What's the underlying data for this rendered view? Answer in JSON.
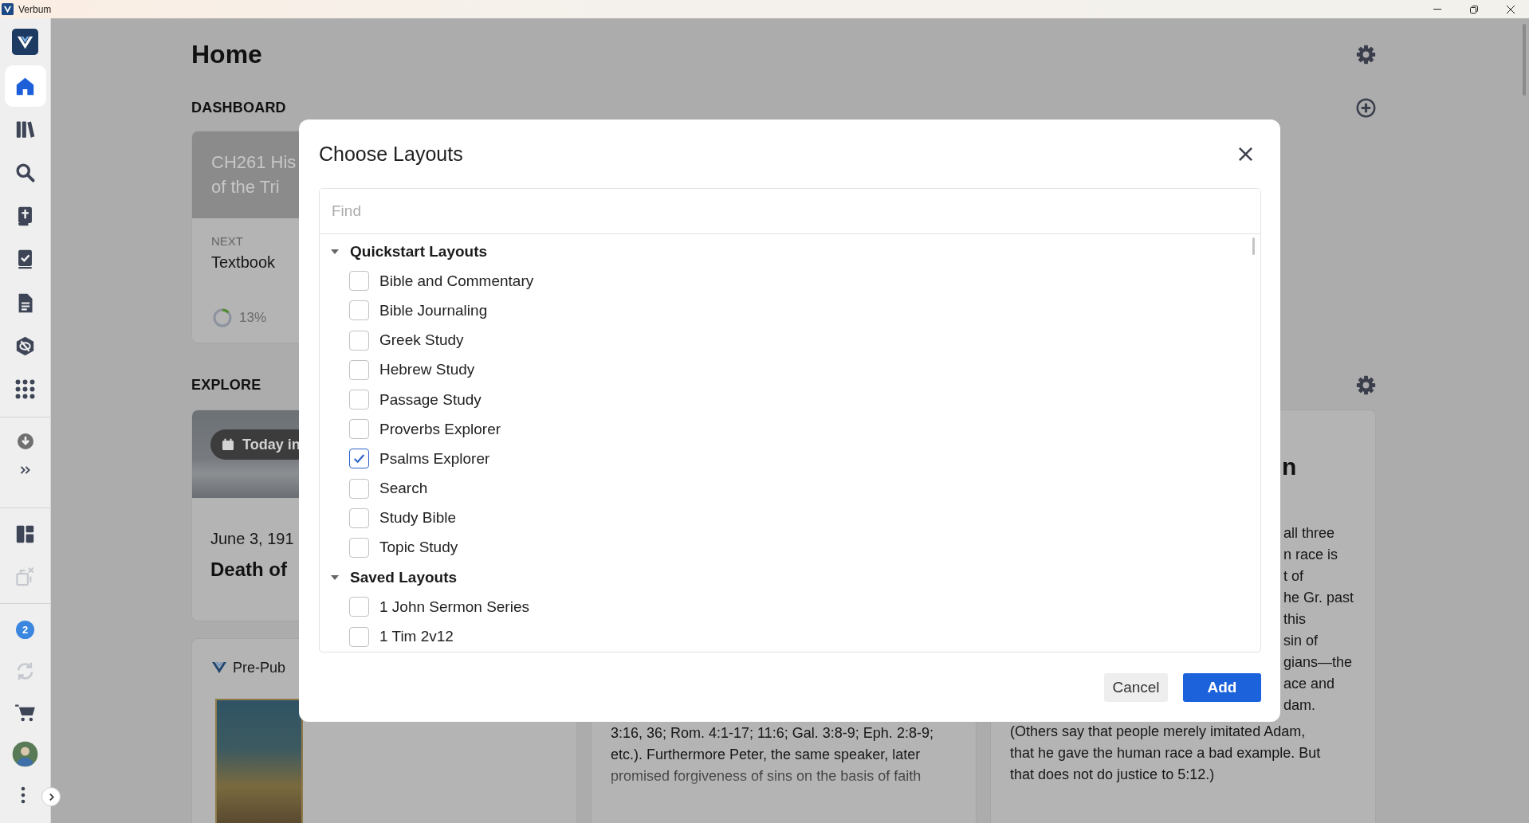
{
  "window": {
    "title": "Verbum"
  },
  "sidebar": {
    "groups": [
      {
        "items": [
          {
            "kind": "home",
            "selected": true,
            "disabled": false
          },
          {
            "kind": "library",
            "selected": false,
            "disabled": false
          },
          {
            "kind": "search",
            "selected": false,
            "disabled": false
          },
          {
            "kind": "bible",
            "selected": false,
            "disabled": false
          },
          {
            "kind": "plans",
            "selected": false,
            "disabled": false
          },
          {
            "kind": "documents",
            "selected": false,
            "disabled": false
          },
          {
            "kind": "shield",
            "selected": false,
            "disabled": false
          },
          {
            "kind": "apps",
            "selected": false,
            "disabled": false
          }
        ]
      },
      {
        "items": [
          {
            "kind": "download",
            "selected": false,
            "disabled": false
          },
          {
            "kind": "more",
            "selected": false,
            "disabled": false
          }
        ]
      },
      {
        "items": [
          {
            "kind": "layouts",
            "selected": false,
            "disabled": false
          },
          {
            "kind": "close-layouts",
            "selected": false,
            "disabled": true
          }
        ]
      },
      {
        "items": [
          {
            "kind": "notifications",
            "badge": "2",
            "selected": false,
            "disabled": false
          },
          {
            "kind": "sync",
            "selected": false,
            "disabled": true
          },
          {
            "kind": "cart",
            "selected": false,
            "disabled": false
          },
          {
            "kind": "account",
            "selected": false,
            "disabled": false
          },
          {
            "kind": "menu",
            "selected": false,
            "disabled": false
          }
        ]
      }
    ]
  },
  "page": {
    "title": "Home"
  },
  "dashboard": {
    "heading": "DASHBOARD",
    "cards": [
      {
        "title": "CH261 His\nof the Tri",
        "next_label": "NEXT",
        "next_item": "Textbook",
        "progress": {
          "level": 0.13,
          "label": "13%"
        }
      }
    ]
  },
  "explore": {
    "heading": "EXPLORE",
    "columns": [
      {
        "cards": [
          {
            "kind": "history",
            "tag": "Today in",
            "date": "June 3, 191",
            "title": "Death of"
          },
          {
            "kind": "prepub",
            "label": "Pre-Pub"
          }
        ]
      },
      {
        "cards": [
          {
            "kind": "excerpt",
            "text": "3:16, 36; Rom. 4:1-17; 11:6; Gal. 3:8-9; Eph. 2:8-9;\netc.). Furthermore Peter, the same speaker, later\npromised forgiveness of sins on the basis of faith"
          }
        ]
      },
      {
        "cards": [
          {
            "kind": "excerpt",
            "heading": "n",
            "fragment": "all three\nn race is\nt of\nhe Gr. past\nthis\nsin of\ngians—the\nace and\ndam.",
            "text": "(Others say that people merely imitated Adam,\nthat he gave the human race a bad example. But\nthat does not do justice to 5:12.)"
          }
        ]
      }
    ]
  },
  "dialog": {
    "title": "Choose Layouts",
    "search": {
      "placeholder": "Find"
    },
    "groups": [
      {
        "label": "Quickstart Layouts",
        "expanded": true,
        "children": [
          {
            "label": "Bible and Commentary",
            "checked": false
          },
          {
            "label": "Bible Journaling",
            "checked": false
          },
          {
            "label": "Greek Study",
            "checked": false
          },
          {
            "label": "Hebrew Study",
            "checked": false
          },
          {
            "label": "Passage Study",
            "checked": false
          },
          {
            "label": "Proverbs Explorer",
            "checked": false
          },
          {
            "label": "Psalms Explorer",
            "checked": true
          },
          {
            "label": "Search",
            "checked": false
          },
          {
            "label": "Study Bible",
            "checked": false
          },
          {
            "label": "Topic Study",
            "checked": false
          }
        ]
      },
      {
        "label": "Saved Layouts",
        "expanded": true,
        "children": [
          {
            "label": "1 John Sermon Series",
            "checked": false
          },
          {
            "label": "1 Tim 2v12",
            "checked": false
          }
        ]
      }
    ],
    "buttons": [
      {
        "label": "Cancel",
        "kind": "secondary"
      },
      {
        "label": "Add",
        "kind": "primary"
      }
    ]
  }
}
